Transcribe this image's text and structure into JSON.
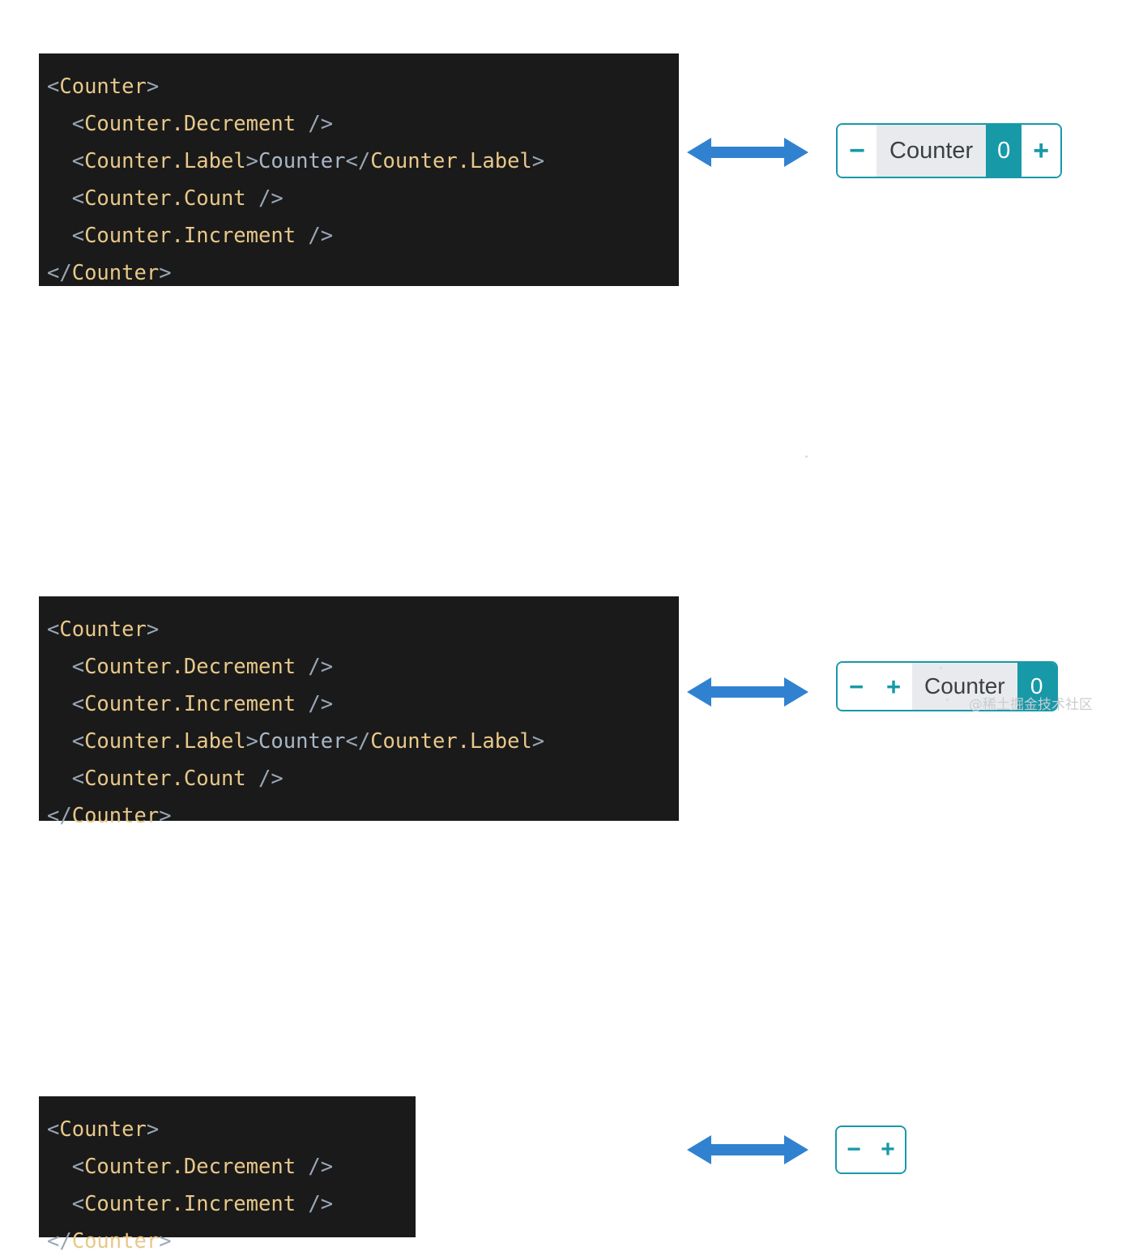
{
  "page": {
    "background_color": "#ffffff",
    "watermark": "@稀土掘金技术社区"
  },
  "theme": {
    "code_background": "#1a1a1a",
    "code_punctuation": "#9aa7b6",
    "code_tag": "#e8c88a",
    "code_text": "#a9b7c6",
    "accent_teal": "#1799a8",
    "arrow_blue": "#3082d0",
    "label_gray_bg": "#e8eaed",
    "label_text": "#3c4043"
  },
  "rows": [
    {
      "code": {
        "lines": [
          [
            {
              "t": "<",
              "c": "pk"
            },
            {
              "t": "Counter",
              "c": "tag"
            },
            {
              "t": ">",
              "c": "pk"
            }
          ],
          [
            {
              "t": "  <",
              "c": "pk"
            },
            {
              "t": "Counter.Decrement",
              "c": "tag"
            },
            {
              "t": " />",
              "c": "pk"
            }
          ],
          [
            {
              "t": "  <",
              "c": "pk"
            },
            {
              "t": "Counter.Label",
              "c": "tag"
            },
            {
              "t": ">",
              "c": "pk"
            },
            {
              "t": "Counter",
              "c": "txt"
            },
            {
              "t": "</",
              "c": "pk"
            },
            {
              "t": "Counter.Label",
              "c": "tag"
            },
            {
              "t": ">",
              "c": "pk"
            }
          ],
          [
            {
              "t": "  <",
              "c": "pk"
            },
            {
              "t": "Counter.Count",
              "c": "tag"
            },
            {
              "t": " />",
              "c": "pk"
            }
          ],
          [
            {
              "t": "  <",
              "c": "pk"
            },
            {
              "t": "Counter.Increment",
              "c": "tag"
            },
            {
              "t": " />",
              "c": "pk"
            }
          ],
          [
            {
              "t": "</",
              "c": "pk"
            },
            {
              "t": "Counter",
              "c": "tag"
            },
            {
              "t": ">",
              "c": "pk"
            }
          ]
        ]
      },
      "arrow": "double-headed-arrow",
      "widget": {
        "segments": [
          {
            "kind": "decrement",
            "label": "−"
          },
          {
            "kind": "label",
            "label": "Counter"
          },
          {
            "kind": "count",
            "label": "0"
          },
          {
            "kind": "increment",
            "label": "+"
          }
        ]
      }
    },
    {
      "code": {
        "lines": [
          [
            {
              "t": "<",
              "c": "pk"
            },
            {
              "t": "Counter",
              "c": "tag"
            },
            {
              "t": ">",
              "c": "pk"
            }
          ],
          [
            {
              "t": "  <",
              "c": "pk"
            },
            {
              "t": "Counter.Decrement",
              "c": "tag"
            },
            {
              "t": " />",
              "c": "pk"
            }
          ],
          [
            {
              "t": "  <",
              "c": "pk"
            },
            {
              "t": "Counter.Increment",
              "c": "tag"
            },
            {
              "t": " />",
              "c": "pk"
            }
          ],
          [
            {
              "t": "  <",
              "c": "pk"
            },
            {
              "t": "Counter.Label",
              "c": "tag"
            },
            {
              "t": ">",
              "c": "pk"
            },
            {
              "t": "Counter",
              "c": "txt"
            },
            {
              "t": "</",
              "c": "pk"
            },
            {
              "t": "Counter.Label",
              "c": "tag"
            },
            {
              "t": ">",
              "c": "pk"
            }
          ],
          [
            {
              "t": "  <",
              "c": "pk"
            },
            {
              "t": "Counter.Count",
              "c": "tag"
            },
            {
              "t": " />",
              "c": "pk"
            }
          ],
          [
            {
              "t": "</",
              "c": "pk"
            },
            {
              "t": "Counter",
              "c": "tag"
            },
            {
              "t": ">",
              "c": "pk"
            }
          ]
        ]
      },
      "arrow": "double-headed-arrow",
      "widget": {
        "segments": [
          {
            "kind": "decrement",
            "label": "−"
          },
          {
            "kind": "increment",
            "label": "+"
          },
          {
            "kind": "label",
            "label": "Counter"
          },
          {
            "kind": "count",
            "label": "0"
          }
        ]
      }
    },
    {
      "code": {
        "lines": [
          [
            {
              "t": "<",
              "c": "pk"
            },
            {
              "t": "Counter",
              "c": "tag"
            },
            {
              "t": ">",
              "c": "pk"
            }
          ],
          [
            {
              "t": "  <",
              "c": "pk"
            },
            {
              "t": "Counter.Decrement",
              "c": "tag"
            },
            {
              "t": " />",
              "c": "pk"
            }
          ],
          [
            {
              "t": "  <",
              "c": "pk"
            },
            {
              "t": "Counter.Increment",
              "c": "tag"
            },
            {
              "t": " />",
              "c": "pk"
            }
          ],
          [
            {
              "t": "</",
              "c": "pk"
            },
            {
              "t": "Counter",
              "c": "tag"
            },
            {
              "t": ">",
              "c": "pk"
            }
          ]
        ]
      },
      "arrow": "double-headed-arrow",
      "widget": {
        "segments": [
          {
            "kind": "decrement",
            "label": "−"
          },
          {
            "kind": "increment",
            "label": "+"
          }
        ]
      }
    }
  ]
}
